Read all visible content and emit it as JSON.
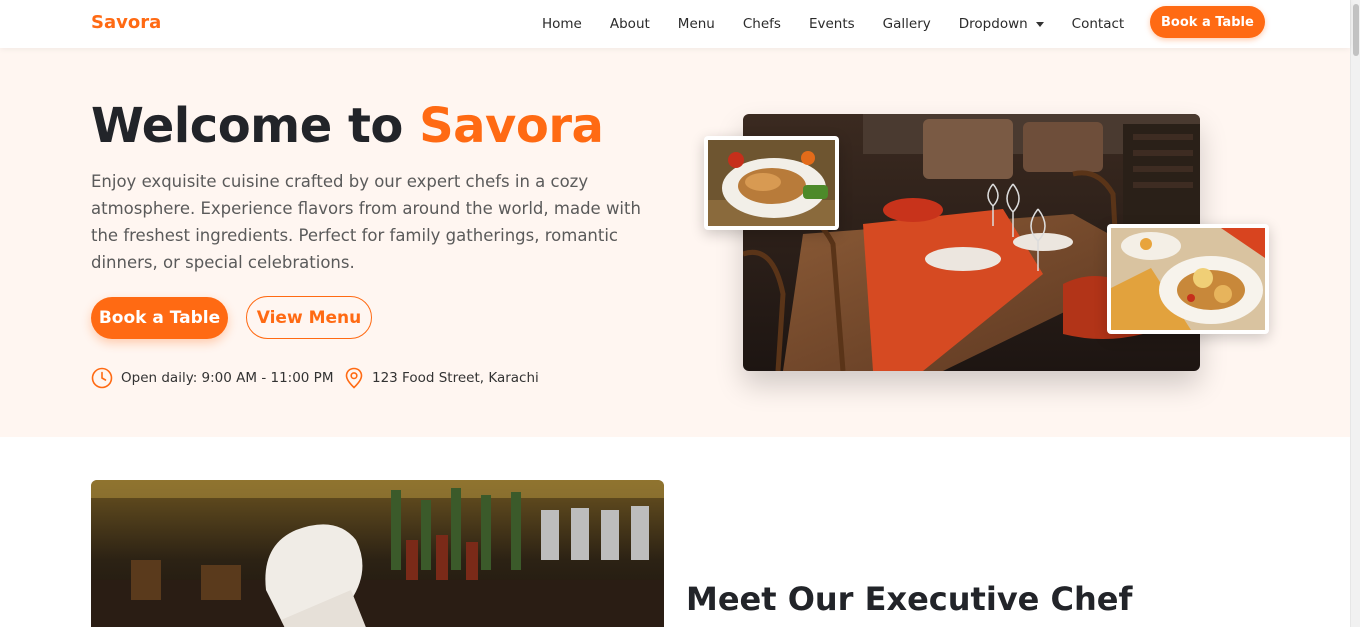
{
  "nav": {
    "brand": "Savora",
    "links": [
      "Home",
      "About",
      "Menu",
      "Chefs",
      "Events",
      "Gallery",
      "Dropdown",
      "Contact"
    ],
    "book_label": "Book a Table"
  },
  "hero": {
    "title_prefix": "Welcome to ",
    "title_accent": "Savora",
    "description": "Enjoy exquisite cuisine crafted by our expert chefs in a cozy atmosphere. Experience flavors from around the world, made with the freshest ingredients. Perfect for family gatherings, romantic dinners, or special celebrations.",
    "primary_button": "Book a Table",
    "secondary_button": "View Menu",
    "hours": "Open daily: 9:00 AM - 11:00 PM",
    "address": "123 Food Street, Karachi"
  },
  "chef": {
    "title": "Meet Our Executive Chef"
  },
  "colors": {
    "accent": "#ff6a13",
    "hero_bg": "#fff6f1",
    "heading": "#222429"
  }
}
